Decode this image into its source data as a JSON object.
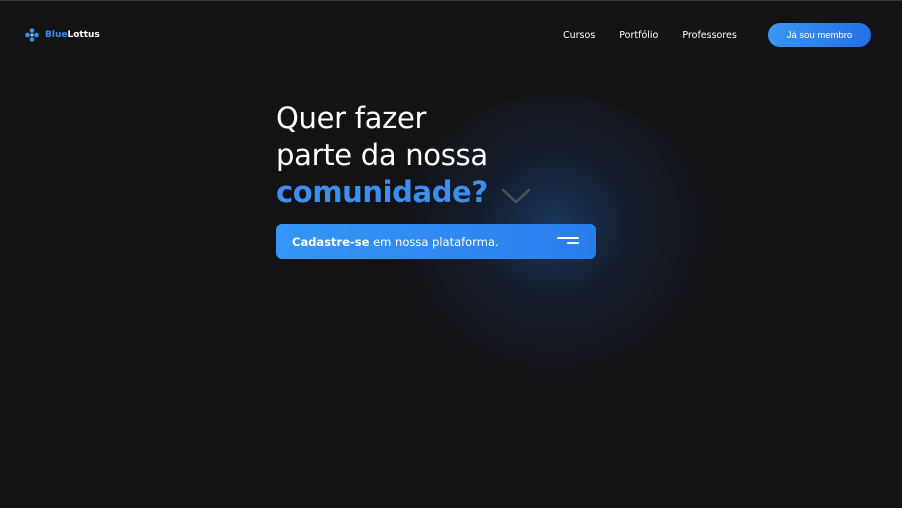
{
  "header": {
    "logo": {
      "icon": "lotus-dots-icon",
      "brand_accent": "Blue",
      "brand_rest": "Lottus"
    },
    "nav": [
      {
        "label": "Cursos"
      },
      {
        "label": "Portfólio"
      },
      {
        "label": "Professores"
      }
    ],
    "member_button": "Já sou membro"
  },
  "hero": {
    "line1": "Quer fazer",
    "line2": "parte da nossa",
    "line3": "comunidade?",
    "chevron_icon": "chevron-down-icon",
    "cta": {
      "strong": "Cadastre-se",
      "rest": " em nossa plataforma.",
      "icon": "menu-lines-icon"
    }
  },
  "colors": {
    "background": "#131316",
    "accent": "#3b8ff0",
    "button_gradient_start": "#3a97f3",
    "button_gradient_end": "#2270e6"
  }
}
